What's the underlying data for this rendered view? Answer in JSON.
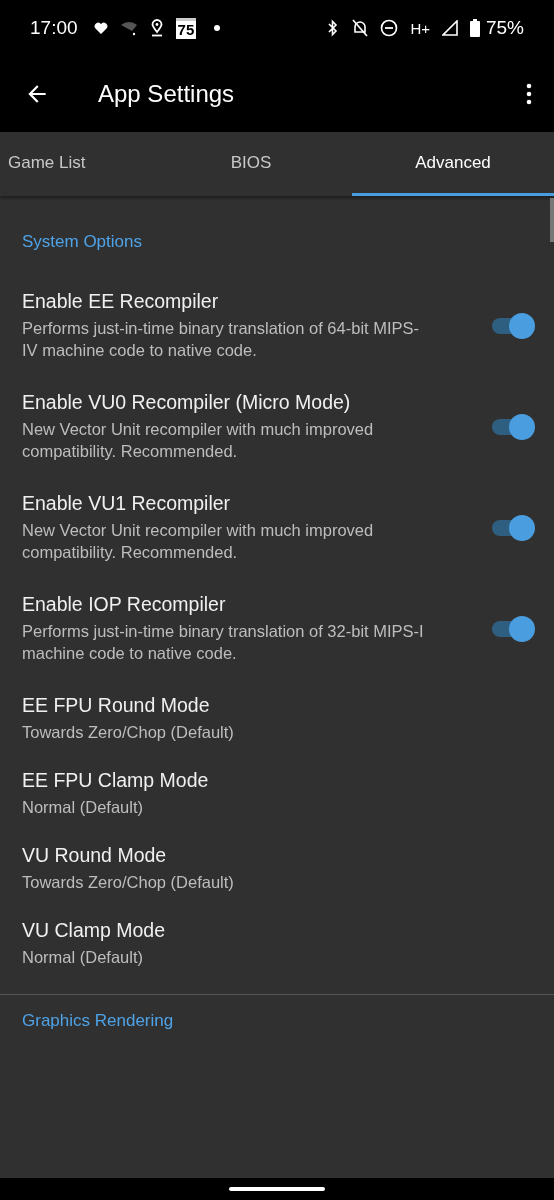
{
  "status_bar": {
    "time": "17:00",
    "calendar_day": "75",
    "network": "H+",
    "battery": "75%"
  },
  "app_bar": {
    "title": "App Settings"
  },
  "tabs": [
    {
      "label": "Game List",
      "selected": false
    },
    {
      "label": "BIOS",
      "selected": false
    },
    {
      "label": "Advanced",
      "selected": true
    }
  ],
  "sections": [
    {
      "title": "System Options",
      "settings": [
        {
          "kind": "switch",
          "title": "Enable EE Recompiler",
          "summary": "Performs just-in-time binary translation of 64-bit MIPS-IV machine code to native code.",
          "on": true
        },
        {
          "kind": "switch",
          "title": "Enable VU0 Recompiler (Micro Mode)",
          "summary": "New Vector Unit recompiler with much improved compatibility. Recommended.",
          "on": true
        },
        {
          "kind": "switch",
          "title": "Enable VU1 Recompiler",
          "summary": "New Vector Unit recompiler with much improved compatibility. Recommended.",
          "on": true
        },
        {
          "kind": "switch",
          "title": "Enable IOP Recompiler",
          "summary": "Performs just-in-time binary translation of 32-bit MIPS-I machine code to native code.",
          "on": true
        },
        {
          "kind": "value",
          "title": "EE FPU Round Mode",
          "summary": "Towards Zero/Chop (Default)"
        },
        {
          "kind": "value",
          "title": "EE FPU Clamp Mode",
          "summary": "Normal (Default)"
        },
        {
          "kind": "value",
          "title": "VU Round Mode",
          "summary": "Towards Zero/Chop (Default)"
        },
        {
          "kind": "value",
          "title": "VU Clamp Mode",
          "summary": "Normal (Default)"
        }
      ]
    },
    {
      "title": "Graphics Rendering"
    }
  ]
}
